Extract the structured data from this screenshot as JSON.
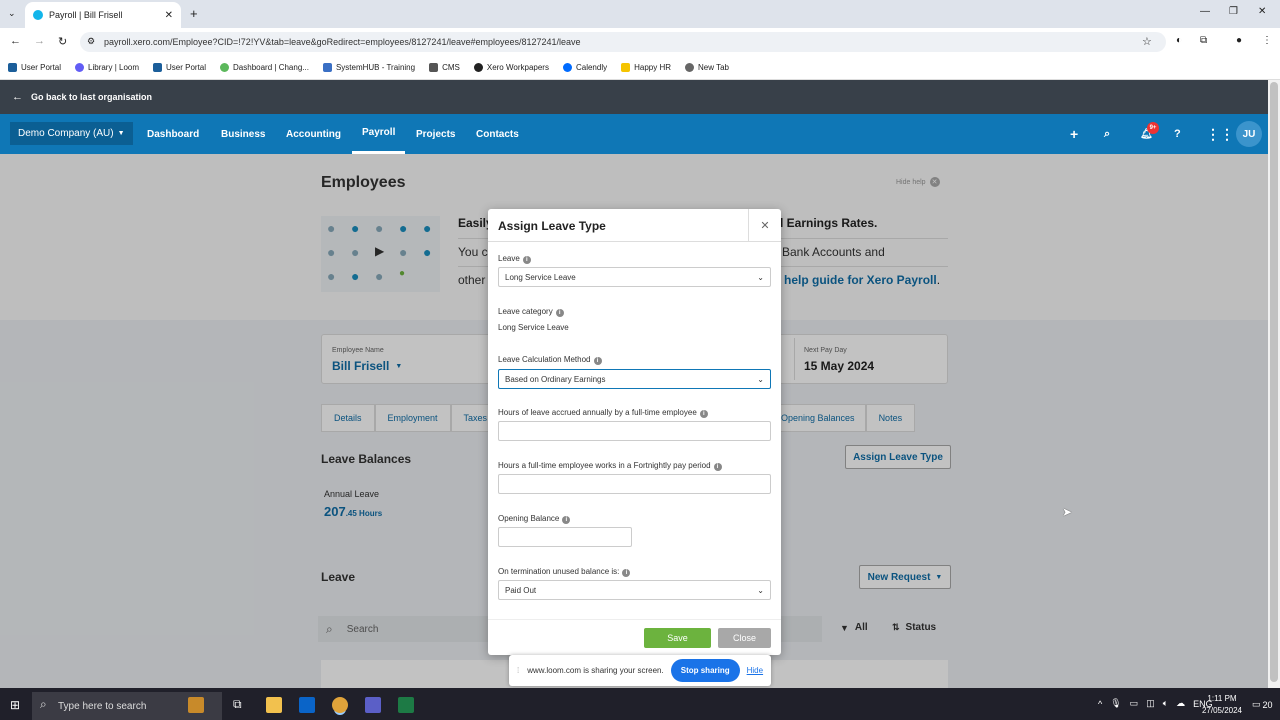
{
  "browser": {
    "tab_title": "Payroll | Bill Frisell",
    "url": "payroll.xero.com/Employee?CID=!72!YV&tab=leave&goRedirect=employees/8127241/leave#employees/8127241/leave",
    "bookmarks": [
      "User Portal",
      "Library | Loom",
      "User Portal",
      "Dashboard | Chang...",
      "SystemHUB - Training",
      "CMS",
      "Xero Workpapers",
      "Calendly",
      "Happy HR",
      "New Tab"
    ]
  },
  "xero": {
    "back_link": "Go back to last organisation",
    "org_name": "Demo Company (AU)",
    "nav": [
      "Dashboard",
      "Business",
      "Accounting",
      "Payroll",
      "Projects",
      "Contacts"
    ],
    "notification_count": "9+",
    "user_initials": "JU"
  },
  "employee_page": {
    "title": "Employees",
    "hide_help": "Hide help",
    "promo_heading_start": "Easily",
    "promo_heading_end": "d Earnings Rates.",
    "promo_line1_start": "You c",
    "promo_line1_end": "Bank Accounts and",
    "promo_line2_start": "other",
    "promo_link": "r help guide for Xero Payroll",
    "promo_period": ".",
    "employee_name_label": "Employee Name",
    "employee_name": "Bill Frisell",
    "next_pay_label": "Next Pay Day",
    "next_pay_date": "15 May 2024",
    "tabs": [
      "Details",
      "Employment",
      "Taxes",
      "Opening Balances",
      "Notes"
    ],
    "leave_balances_title": "Leave Balances",
    "assign_leave_button": "Assign Leave Type",
    "annual_leave_label": "Annual Leave",
    "annual_leave_value": "207",
    "annual_leave_unit": ".45 Hours",
    "leave_title": "Leave",
    "new_request_button": "New Request",
    "search_placeholder": "Search",
    "filter_all": "All",
    "filter_status": "Status"
  },
  "modal": {
    "title": "Assign Leave Type",
    "leave_label": "Leave",
    "leave_value": "Long Service Leave",
    "category_label": "Leave category",
    "category_value": "Long Service Leave",
    "method_label": "Leave Calculation Method",
    "method_value": "Based on Ordinary Earnings",
    "hours_accrued_label": "Hours of leave accrued annually by a full-time employee",
    "hours_period_label": "Hours a full-time employee works in a Fortnightly pay period",
    "opening_balance_label": "Opening Balance",
    "termination_label": "On termination unused balance is:",
    "termination_value": "Paid Out",
    "save_button": "Save",
    "close_button": "Close"
  },
  "loom": {
    "message": "www.loom.com is sharing your screen.",
    "stop_button": "Stop sharing",
    "hide_link": "Hide"
  },
  "taskbar": {
    "search_placeholder": "Type here to search",
    "language": "ENG",
    "time": "1:11 PM",
    "date": "27/05/2024",
    "notifications": "20"
  },
  "colors": {
    "xero_blue": "#0f77b6",
    "save_green": "#6cb33e",
    "link_blue": "#0f6ea8"
  }
}
